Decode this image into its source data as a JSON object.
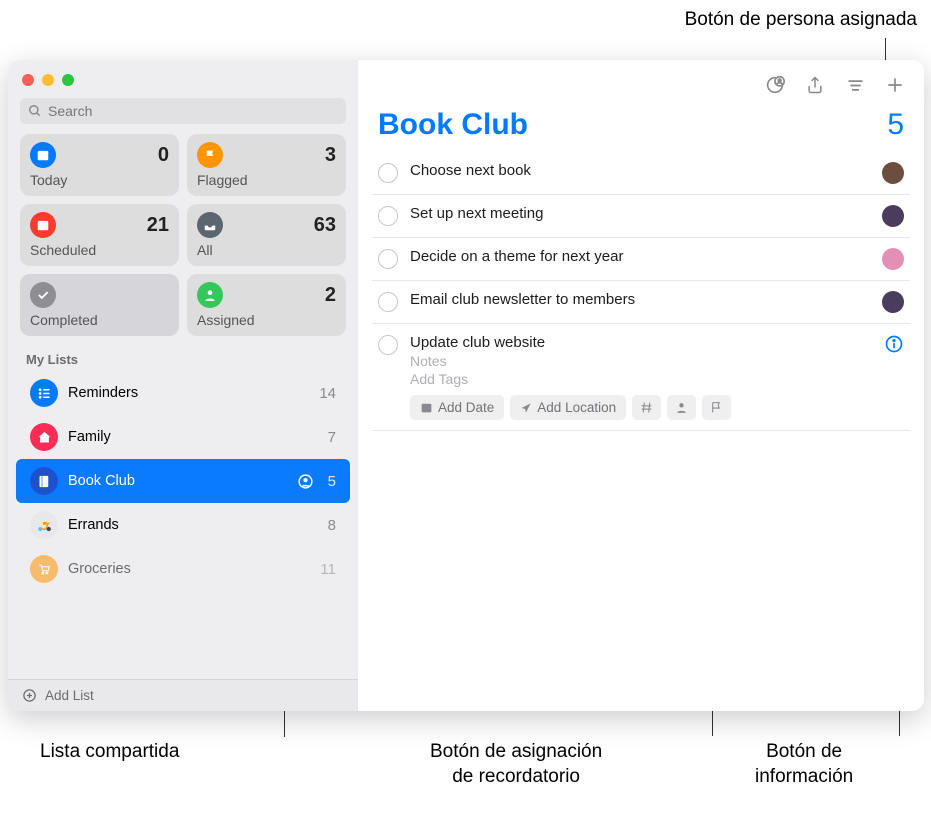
{
  "callouts": {
    "top": "Botón de persona asignada",
    "bottomLeft": "Lista compartida",
    "bottomMiddle": "Botón de asignación\nde recordatorio",
    "bottomRight": "Botón de\ninformación"
  },
  "search": {
    "placeholder": "Search"
  },
  "smartLists": [
    {
      "label": "Today",
      "count": 0,
      "color": "#007aff",
      "icon": "calendar"
    },
    {
      "label": "Flagged",
      "count": 3,
      "color": "#ff9500",
      "icon": "flag"
    },
    {
      "label": "Scheduled",
      "count": 21,
      "color": "#ff3b30",
      "icon": "calendar"
    },
    {
      "label": "All",
      "count": 63,
      "color": "#5b6670",
      "icon": "tray"
    },
    {
      "label": "Completed",
      "count": "",
      "color": "#8e8e93",
      "icon": "check"
    },
    {
      "label": "Assigned",
      "count": 2,
      "color": "#34c759",
      "icon": "person"
    }
  ],
  "sectionHeader": "My Lists",
  "lists": [
    {
      "name": "Reminders",
      "count": 14,
      "color": "#007aff",
      "icon": "list"
    },
    {
      "name": "Family",
      "count": 7,
      "color": "#ff2d55",
      "icon": "home"
    },
    {
      "name": "Book Club",
      "count": 5,
      "color": "#2255dd",
      "icon": "book",
      "selected": true,
      "shared": true
    },
    {
      "name": "Errands",
      "count": 8,
      "color": "#e8e8ea",
      "icon": "scooter"
    },
    {
      "name": "Groceries",
      "count": 11,
      "color": "#ff9500",
      "icon": "cart"
    }
  ],
  "addList": "Add List",
  "main": {
    "title": "Book Club",
    "count": 5,
    "reminders": [
      {
        "title": "Choose next book",
        "assigneeColor": "#6b4e3d"
      },
      {
        "title": "Set up next meeting",
        "assigneeColor": "#4a3c5c"
      },
      {
        "title": "Decide on a theme for next year",
        "assigneeColor": "#e48fb5"
      },
      {
        "title": "Email club newsletter to members",
        "assigneeColor": "#4a3c5c"
      }
    ],
    "expanded": {
      "title": "Update club website",
      "notes": "Notes",
      "addTags": "Add Tags",
      "addDate": "Add Date",
      "addLocation": "Add Location"
    }
  }
}
